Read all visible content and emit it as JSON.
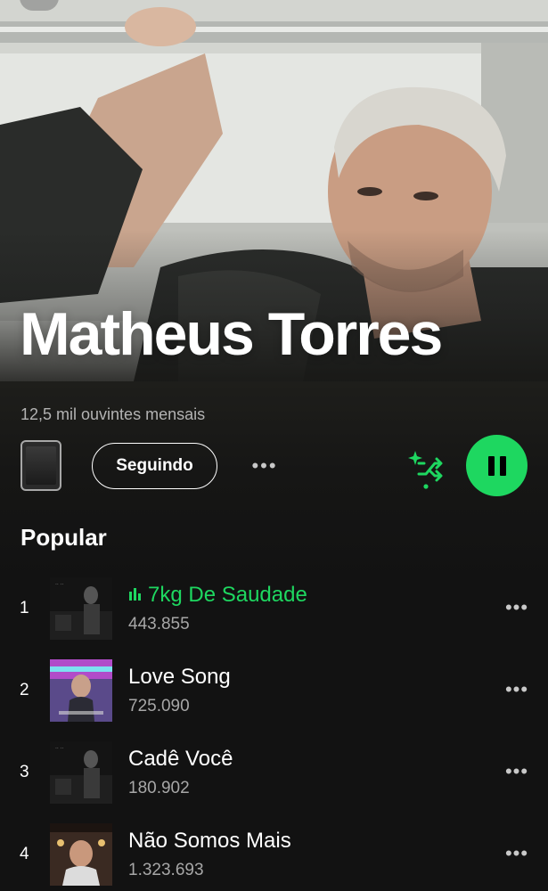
{
  "artist": {
    "name": "Matheus Torres",
    "monthly_listeners": "12,5 mil ouvintes mensais"
  },
  "actions": {
    "follow_label": "Seguindo",
    "more_label": "•••",
    "shuffle_icon": "smart-shuffle-icon",
    "play_state": "playing"
  },
  "section": {
    "title": "Popular"
  },
  "tracks": [
    {
      "rank": "1",
      "title": "7kg De Saudade",
      "plays": "443.855",
      "playing": true
    },
    {
      "rank": "2",
      "title": "Love Song",
      "plays": "725.090",
      "playing": false
    },
    {
      "rank": "3",
      "title": "Cadê Você",
      "plays": "180.902",
      "playing": false
    },
    {
      "rank": "4",
      "title": "Não Somos Mais",
      "plays": "1.323.693",
      "playing": false
    }
  ],
  "colors": {
    "accent": "#1ed760",
    "background": "#121212",
    "secondary_text": "#a7a7a7"
  }
}
